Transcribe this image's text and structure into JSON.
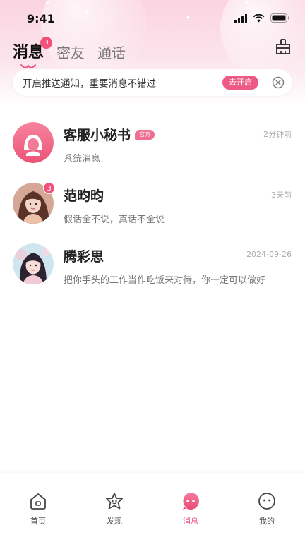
{
  "status_bar": {
    "time": "9:41"
  },
  "tabs": [
    {
      "label": "消息",
      "badge": "3",
      "active": true
    },
    {
      "label": "密友"
    },
    {
      "label": "通话"
    }
  ],
  "notice": {
    "text": "开启推送通知，重要消息不错过",
    "button": "去开启"
  },
  "conversations": [
    {
      "name": "客服小秘书",
      "tag": "官方",
      "time": "2分钟前",
      "message": "系统消息",
      "avatar": "service-avatar"
    },
    {
      "name": "范昀昀",
      "badge": "3",
      "time": "3天前",
      "message": "假话全不说，真话不全说",
      "avatar": "user-avatar"
    },
    {
      "name": "腾彩思",
      "time": "2024-09-26",
      "message": "把你手头的工作当作吃饭来对待，你一定可以做好",
      "avatar": "user-avatar"
    }
  ],
  "bottom_nav": [
    {
      "label": "首页",
      "icon": "home-icon"
    },
    {
      "label": "发现",
      "icon": "discover-icon"
    },
    {
      "label": "消息",
      "icon": "message-icon",
      "active": true
    },
    {
      "label": "我的",
      "icon": "profile-icon"
    }
  ],
  "colors": {
    "accent": "#ee5a86",
    "badge": "#f0507a",
    "header_bg": "#fbd3e1"
  }
}
